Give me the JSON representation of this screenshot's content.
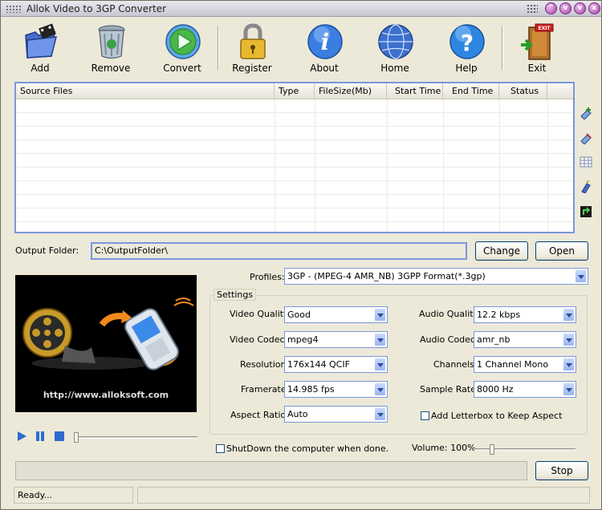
{
  "window": {
    "title": "Allok Video to 3GP Converter"
  },
  "toolbar": {
    "add": "Add",
    "remove": "Remove",
    "convert": "Convert",
    "register": "Register",
    "about": "About",
    "home": "Home",
    "help": "Help",
    "exit": "Exit"
  },
  "file_list": {
    "columns": [
      "Source Files",
      "Type",
      "FileSize(Mb)",
      "Start Time",
      "End Time",
      "Status"
    ]
  },
  "output": {
    "label": "Output Folder:",
    "value": "C:\\OutputFolder\\",
    "change": "Change",
    "open": "Open"
  },
  "preview": {
    "url": "http://www.alloksoft.com"
  },
  "profiles": {
    "label": "Profiles:",
    "value": "3GP - (MPEG-4 AMR_NB) 3GPP Format(*.3gp)"
  },
  "settings": {
    "title": "Settings",
    "video_quality": {
      "label": "Video Quality:",
      "value": "Good"
    },
    "video_codec": {
      "label": "Video Codec:",
      "value": "mpeg4"
    },
    "resolution": {
      "label": "Resolution:",
      "value": "176x144 QCIF"
    },
    "framerate": {
      "label": "Framerate:",
      "value": "14.985 fps"
    },
    "aspect_ratio": {
      "label": "Aspect Ratio:",
      "value": "Auto"
    },
    "audio_quality": {
      "label": "Audio Quality:",
      "value": "12.2  kbps"
    },
    "audio_codec": {
      "label": "Audio Codec:",
      "value": "amr_nb"
    },
    "channels": {
      "label": "Channels:",
      "value": "1 Channel Mono"
    },
    "sample_rate": {
      "label": "Sample Rate:",
      "value": "8000 Hz"
    },
    "letterbox": "Add Letterbox to Keep Aspect"
  },
  "shutdown": "ShutDown the computer when done.",
  "volume": {
    "label": "Volume: 100%",
    "level": 1.0
  },
  "stop": "Stop",
  "status": "Ready...",
  "colors": {
    "accent": "#7a96df",
    "window_bg": "#ece9d8"
  }
}
